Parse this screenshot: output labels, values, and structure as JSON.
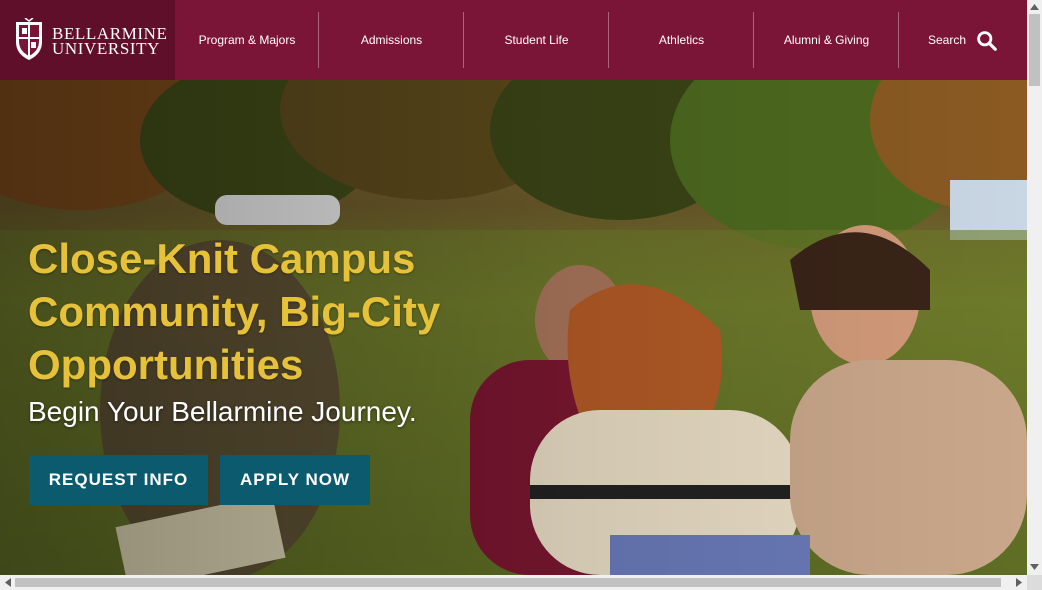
{
  "header": {
    "logo": {
      "line1": "BELLARMINE",
      "line2": "UNIVERSITY"
    },
    "nav": [
      {
        "label": "Program & Majors"
      },
      {
        "label": "Admissions"
      },
      {
        "label": "Student Life"
      },
      {
        "label": "Athletics"
      },
      {
        "label": "Alumni & Giving"
      }
    ],
    "search_label": "Search",
    "search_icon": "magnifier-icon"
  },
  "hero": {
    "headline": "Close-Knit Campus Community, Big-City Opportunities",
    "subhead": "Begin Your Bellarmine Journey.",
    "buttons": {
      "request_info": "REQUEST INFO",
      "apply_now": "APPLY NOW"
    }
  },
  "colors": {
    "brand": "#7b1538",
    "brand_dark": "#5f0f2a",
    "headline_gold": "#e6c13a",
    "button_teal": "#0b5a6e"
  }
}
